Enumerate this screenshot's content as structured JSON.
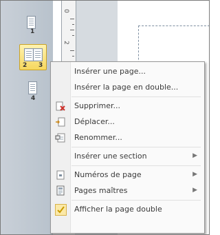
{
  "thumbnails": [
    {
      "label": "1"
    },
    {
      "label": "2"
    },
    {
      "label": "3"
    },
    {
      "label": "4"
    }
  ],
  "ruler": {
    "marks": [
      "0",
      "2"
    ]
  },
  "context_menu": {
    "items": [
      {
        "label": "Insérer une page...",
        "icon": "none",
        "submenu": false
      },
      {
        "label": "Insérer la page en double...",
        "icon": "none",
        "submenu": false
      },
      {
        "label": "Supprimer...",
        "icon": "delete-page-icon",
        "submenu": false
      },
      {
        "label": "Déplacer...",
        "icon": "move-page-icon",
        "submenu": false
      },
      {
        "label": "Renommer...",
        "icon": "rename-page-icon",
        "submenu": false
      },
      {
        "label": "Insérer une section",
        "icon": "none",
        "submenu": true
      },
      {
        "label": "Numéros de page",
        "icon": "page-number-icon",
        "submenu": true
      },
      {
        "label": "Pages maîtres",
        "icon": "master-pages-icon",
        "submenu": true
      },
      {
        "label": "Afficher la page double",
        "icon": "check-icon",
        "submenu": false,
        "checked": true
      }
    ]
  },
  "colors": {
    "selection": "#f6d75e",
    "accent_check": "#d4a800"
  }
}
